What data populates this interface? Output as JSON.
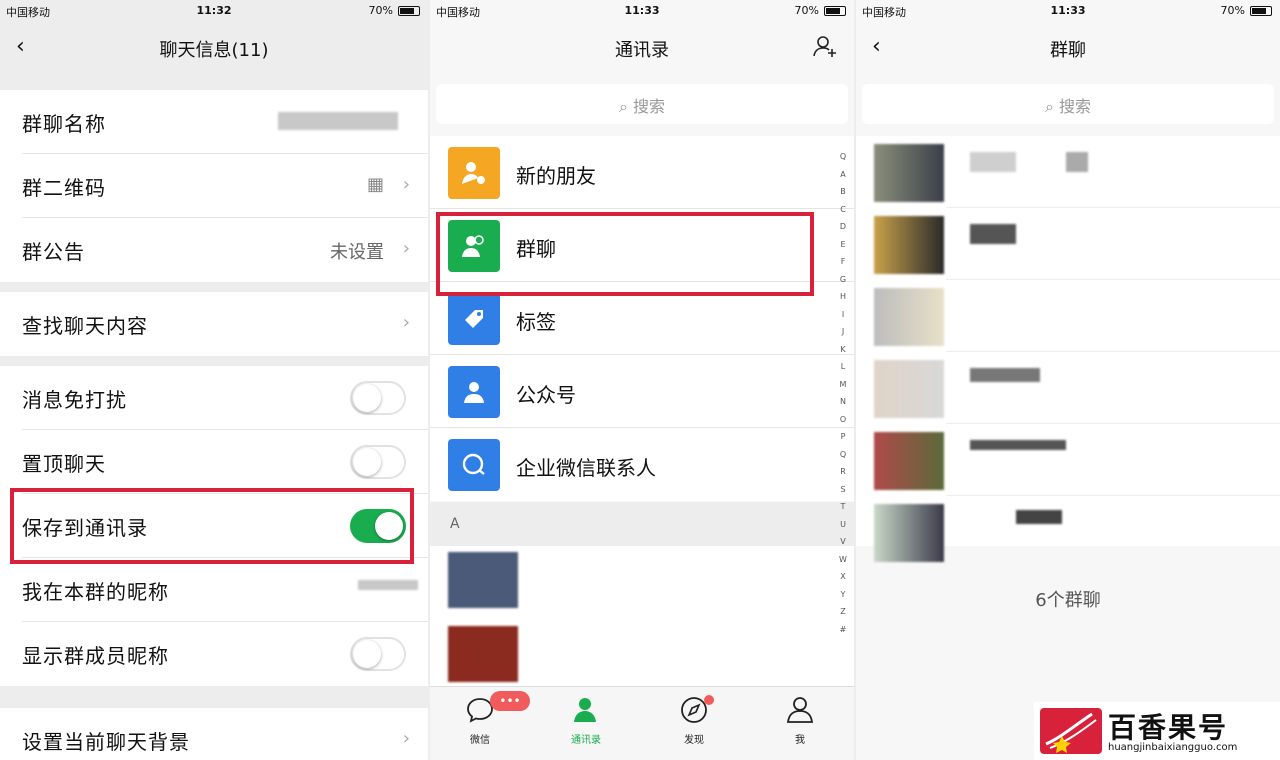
{
  "panel1": {
    "status": {
      "carrier": "中国移动",
      "time": "11:32",
      "battery": "70%"
    },
    "title": "聊天信息(11)",
    "rows": {
      "group_name": "群聊名称",
      "qr": "群二维码",
      "notice": "群公告",
      "notice_value": "未设置",
      "search_chat": "查找聊天内容",
      "mute": "消息免打扰",
      "pin": "置顶聊天",
      "save": "保存到通讯录",
      "nickname": "我在本群的昵称",
      "show_names": "显示群成员昵称",
      "background": "设置当前聊天背景"
    },
    "toggles": {
      "mute": false,
      "pin": false,
      "save": true,
      "show_names": false
    }
  },
  "panel2": {
    "status": {
      "carrier": "中国移动",
      "time": "11:33",
      "battery": "70%"
    },
    "title": "通讯录",
    "search": "搜索",
    "items": [
      {
        "label": "新的朋友",
        "color": "#f5a623",
        "icon": "new-friend-icon"
      },
      {
        "label": "群聊",
        "color": "#1aad4f",
        "icon": "group-chat-icon"
      },
      {
        "label": "标签",
        "color": "#2f7fe6",
        "icon": "tag-icon"
      },
      {
        "label": "公众号",
        "color": "#2f7fe6",
        "icon": "official-account-icon"
      },
      {
        "label": "企业微信联系人",
        "color": "#2f7fe6",
        "icon": "enterprise-contact-icon"
      }
    ],
    "section": "A",
    "alphabet": [
      "Q",
      "A",
      "B",
      "C",
      "D",
      "E",
      "F",
      "G",
      "H",
      "I",
      "J",
      "K",
      "L",
      "M",
      "N",
      "O",
      "P",
      "Q",
      "R",
      "S",
      "T",
      "U",
      "V",
      "W",
      "X",
      "Y",
      "Z",
      "#"
    ],
    "tabs": [
      {
        "label": "微信",
        "icon": "chat-icon"
      },
      {
        "label": "通讯录",
        "icon": "contacts-icon"
      },
      {
        "label": "发现",
        "icon": "discover-icon"
      },
      {
        "label": "我",
        "icon": "me-icon"
      }
    ]
  },
  "panel3": {
    "status": {
      "carrier": "中国移动",
      "time": "11:33",
      "battery": "70%"
    },
    "title": "群聊",
    "search": "搜索",
    "count": "6个群聊"
  },
  "watermark": {
    "name": "百香果号",
    "url": "huangjinbaixiangguo.com"
  },
  "colors": {
    "accent": "#1aad4f",
    "highlight": "#d8223c"
  }
}
